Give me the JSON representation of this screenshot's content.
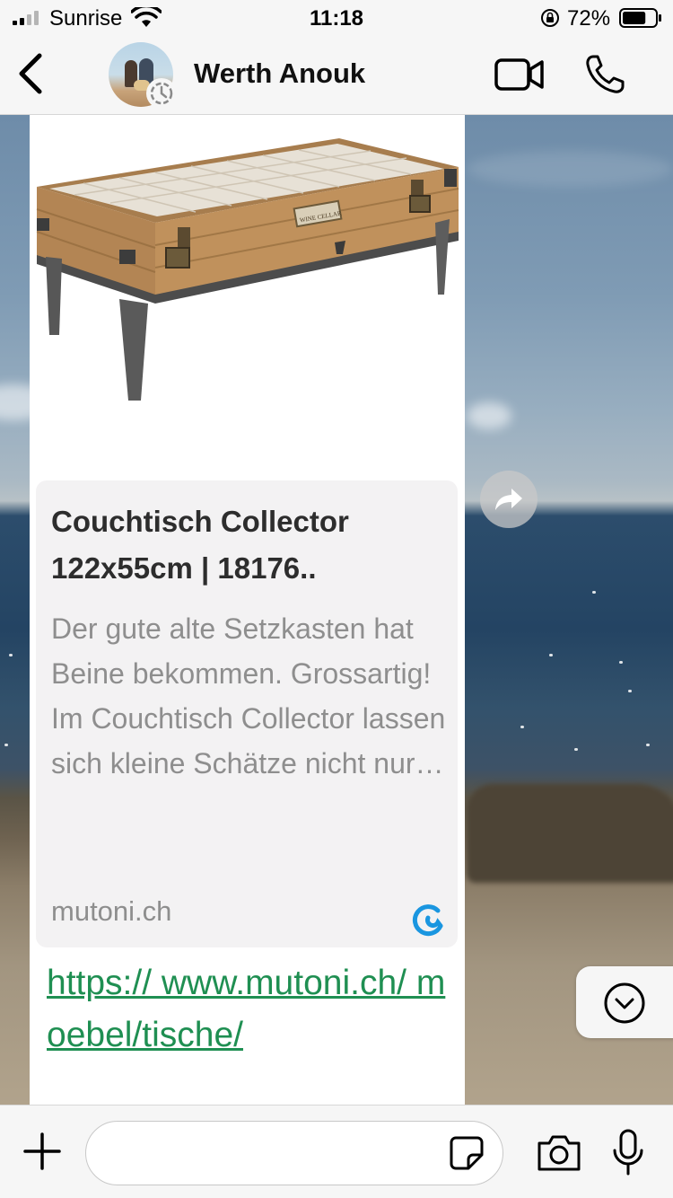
{
  "status_bar": {
    "carrier": "Sunrise",
    "time": "11:18",
    "battery_percent": "72%",
    "battery_level": 0.72
  },
  "header": {
    "contact_name": "Werth Anouk",
    "icons": [
      "back-icon",
      "video-call-icon",
      "phone-icon"
    ]
  },
  "message": {
    "preview": {
      "title": "Couchtisch Collector 122x55cm | 18176..",
      "description": "Der gute alte Setzkasten hat Beine bekommen. Grossartig! Im Couchtisch Collector lassen sich kleine Schätze nicht nur…",
      "domain": "mutoni.ch",
      "product_label": "WINE CELLAR"
    },
    "link_text": "https:// www.mutoni.ch/ moebel/tische/"
  },
  "input_bar": {
    "placeholder": "",
    "icons": [
      "plus-icon",
      "sticker-icon",
      "camera-icon",
      "microphone-icon"
    ]
  },
  "colors": {
    "bar_background": "#f6f6f6",
    "link_green": "#1f8f52",
    "preview_card": "#f3f2f3",
    "logo_blue": "#1a96e0"
  }
}
